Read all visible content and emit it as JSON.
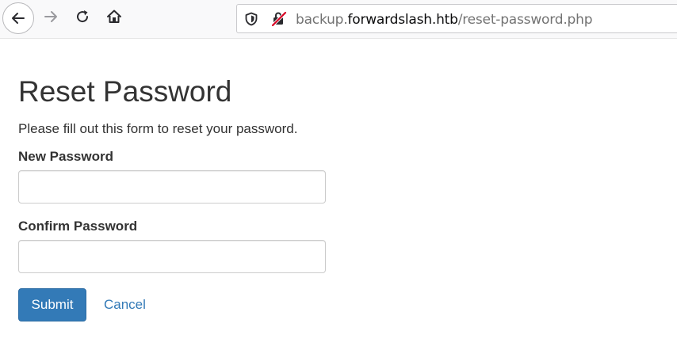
{
  "browser": {
    "url_prefix": "backup.",
    "url_host": "forwardslash.htb",
    "url_path": "/reset-password.php",
    "icons": [
      "back-arrow-icon",
      "forward-arrow-icon",
      "reload-icon",
      "home-icon",
      "tracking-shield-icon",
      "insecure-lock-icon"
    ]
  },
  "form": {
    "title": "Reset Password",
    "subtitle": "Please fill out this form to reset your password.",
    "new_password_label": "New Password",
    "new_password_value": "",
    "confirm_password_label": "Confirm Password",
    "confirm_password_value": "",
    "submit_label": "Submit",
    "cancel_label": "Cancel"
  },
  "colors": {
    "primary": "#337ab7",
    "text": "#333333",
    "input_border": "#cccccc",
    "insecure_red": "#d70022"
  }
}
